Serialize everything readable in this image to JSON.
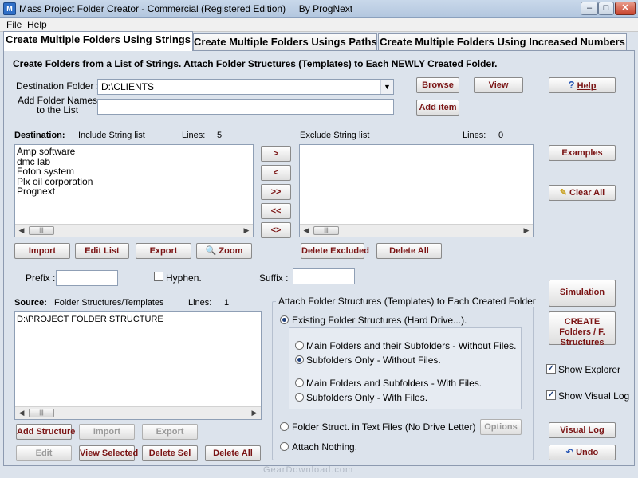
{
  "window": {
    "title": "Mass Project Folder Creator - Commercial (Registered Edition)     By ProgNext",
    "icon_label": "M",
    "min": "–",
    "max": "□",
    "close": "✕"
  },
  "menu": [
    "File",
    "Help"
  ],
  "tabs": [
    {
      "label": "Create Multiple Folders Using Strings",
      "active": true
    },
    {
      "label": "Create Multiple Folders Usings Paths",
      "active": false
    },
    {
      "label": "Create Multiple Folders Using Increased Numbers",
      "active": false
    }
  ],
  "header_text": "Create Folders from a List of Strings. Attach Folder Structures (Templates) to Each NEWLY Created Folder.",
  "destination": {
    "label": "Destination Folder :",
    "value": "D:\\CLIENTS",
    "dropdown_icon": "chevron-down-icon"
  },
  "add_names": {
    "label_line1": "Add Folder Names",
    "label_line2": "to the List",
    "value": "",
    "add_button": "Add item"
  },
  "buttons_top": {
    "browse": "Browse",
    "view": "View",
    "help": "Help"
  },
  "include": {
    "title": "Destination:",
    "subtitle": "Include String list",
    "lines_label": "Lines:",
    "lines_count": "5",
    "items": [
      "Amp software",
      "dmc lab",
      "Foton system",
      "Plx oil corporation",
      "Prognext"
    ]
  },
  "exclude": {
    "title": "Exclude String list",
    "lines_label": "Lines:",
    "lines_count": "0",
    "items": []
  },
  "move_buttons": [
    ">",
    "<",
    ">>",
    "<<",
    "<>"
  ],
  "include_buttons": {
    "import": "Import",
    "edit": "Edit List",
    "export": "Export",
    "zoom": "Zoom"
  },
  "exclude_buttons": {
    "delete_excluded": "Delete Excluded",
    "delete_all": "Delete All"
  },
  "right_buttons": {
    "examples": "Examples",
    "clear_all": "Clear All",
    "simulation": "Simulation",
    "create": "CREATE Folders / F. Structures",
    "visual_log": "Visual Log",
    "undo": "Undo"
  },
  "affix": {
    "prefix_label": "Prefix :",
    "prefix_value": "",
    "hyphen_label": "Hyphen.",
    "hyphen_checked": false,
    "suffix_label": "Suffix :",
    "suffix_value": ""
  },
  "source": {
    "title": "Source:",
    "subtitle": "Folder Structures/Templates",
    "lines_label": "Lines:",
    "lines_count": "1",
    "items": [
      "D:\\PROJECT FOLDER STRUCTURE"
    ]
  },
  "source_buttons": {
    "add_structure": "Add Structure",
    "import": "Import",
    "export": "Export",
    "edit": "Edit",
    "view_selected": "View Selected",
    "delete_sel": "Delete Sel",
    "delete_all": "Delete All"
  },
  "attach": {
    "group_title": "Attach Folder Structures (Templates) to Each Created Folder",
    "existing": "Existing Folder Structures (Hard Drive...).",
    "opt1": "Main Folders and their Subfolders - Without Files.",
    "opt2": "Subfolders Only - Without Files.",
    "opt3": "Main Folders and Subfolders - With Files.",
    "opt4": "Subfolders Only - With Files.",
    "text_files": "Folder Struct. in Text Files (No Drive Letter)",
    "options_button": "Options",
    "nothing": "Attach Nothing."
  },
  "checkboxes": {
    "show_explorer": "Show Explorer",
    "show_visual_log": "Show Visual Log"
  },
  "watermark": "GearDownload.com"
}
